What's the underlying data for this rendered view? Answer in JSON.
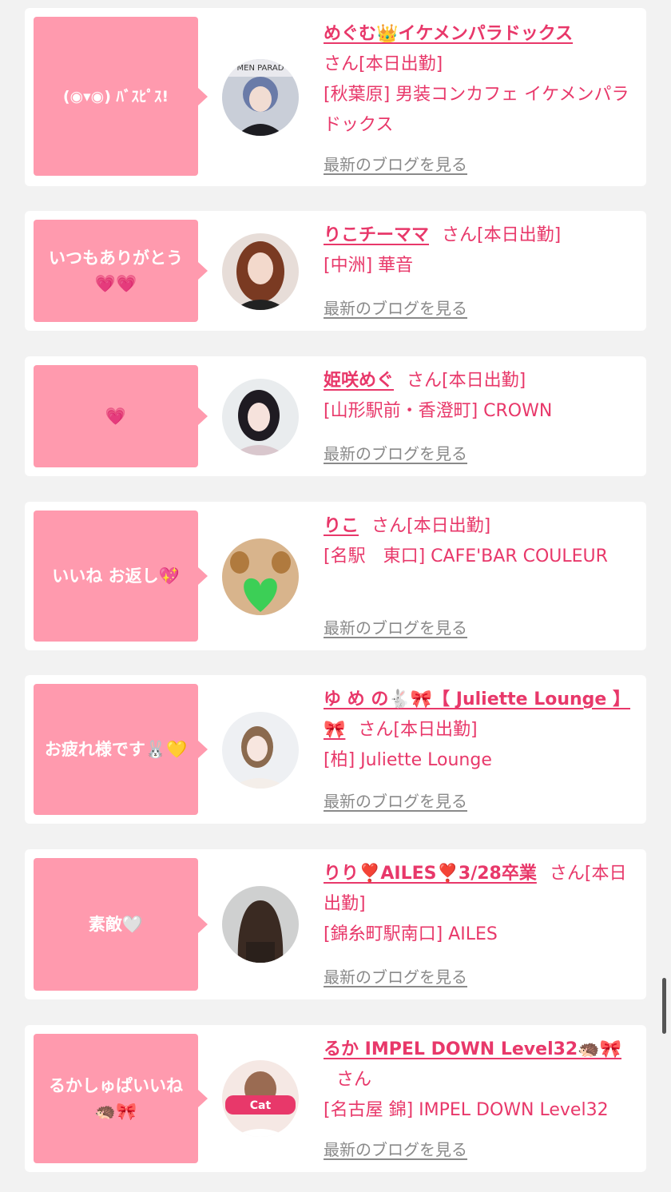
{
  "entries": [
    {
      "comment": "(◉▾◉) ﾊﾞｽﾋﾟｽ!",
      "name": "めぐむ👑イケメンパラドックス",
      "suffix": "さん[本日出勤]",
      "shop": "[秋葉原] 男装コンカフェ イケメンパラドックス",
      "blog_link": "最新のブログを見る",
      "avatar_text": "MEN PARAD"
    },
    {
      "comment": "いつもありがとう💗💗",
      "name": "りこチーママ",
      "suffix": "さん[本日出勤]",
      "shop": "[中洲] 華音",
      "blog_link": "最新のブログを見る"
    },
    {
      "comment": "💗",
      "name": "姫咲めぐ",
      "suffix": "さん[本日出勤]",
      "shop": "[山形駅前・香澄町] CROWN",
      "blog_link": "最新のブログを見る"
    },
    {
      "comment": "いいね お返し💖",
      "name": "りこ",
      "suffix": "さん[本日出勤]",
      "shop": "[名駅　東口] CAFE'BAR COULEUR",
      "blog_link": "最新のブログを見る"
    },
    {
      "comment": "お疲れ様です🐰💛",
      "name": "ゆ め の🐇🎀【 Juliette Lounge 】🎀",
      "suffix": "さん[本日出勤]",
      "shop": "[柏] Juliette Lounge",
      "blog_link": "最新のブログを見る"
    },
    {
      "comment": "素敵🤍",
      "name": "りり❣️AILES❣️3/28卒業",
      "suffix": "さん[本日出勤]",
      "shop": "[錦糸町駅南口] AILES",
      "blog_link": "最新のブログを見る"
    },
    {
      "comment": "るかしゅぱいいね🦔🎀",
      "name": "るか IMPEL DOWN Level32🦔🎀",
      "suffix": "さん",
      "shop": "[名古屋 錦] IMPEL DOWN Level32",
      "blog_link": "最新のブログを見る",
      "avatar_text": "Cat"
    }
  ],
  "colors": {
    "accent": "#e8386a",
    "bubble": "#ff9aae",
    "link_gray": "#8a8a8a",
    "background": "#f2f2f2"
  }
}
